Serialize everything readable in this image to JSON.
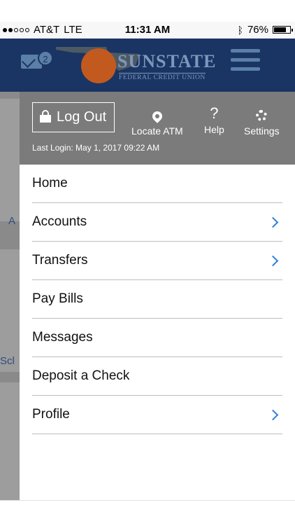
{
  "status_bar": {
    "carrier": "AT&T",
    "network": "LTE",
    "time": "11:31 AM",
    "battery": "76%",
    "battery_level": 0.76,
    "bluetooth_icon": "bluetooth-icon"
  },
  "header": {
    "messages_count": "2",
    "brand_name": "SUNSTATE",
    "brand_sub": "FEDERAL CREDIT UNION",
    "colors": {
      "header_bg": "#1a3563",
      "accent": "#5b7fa6",
      "sun": "#c25a1f"
    }
  },
  "background": {
    "text_a": "A",
    "text_sc": "Scl"
  },
  "drawer": {
    "logout_label": "Log Out",
    "tools": [
      {
        "label": "Locate ATM",
        "icon": "location-pin-icon"
      },
      {
        "label": "Help",
        "icon": "help-icon"
      },
      {
        "label": "Settings",
        "icon": "gear-icon"
      }
    ],
    "last_login": "Last Login: May 1, 2017 09:22 AM",
    "menu": [
      {
        "label": "Home",
        "has_chevron": false
      },
      {
        "label": "Accounts",
        "has_chevron": true
      },
      {
        "label": "Transfers",
        "has_chevron": true
      },
      {
        "label": "Pay Bills",
        "has_chevron": false
      },
      {
        "label": "Messages",
        "has_chevron": false
      },
      {
        "label": "Deposit a Check",
        "has_chevron": false
      },
      {
        "label": "Profile",
        "has_chevron": true
      }
    ],
    "colors": {
      "chevron": "#2d7fd4",
      "drawer_top": "#7b7b7b"
    }
  }
}
